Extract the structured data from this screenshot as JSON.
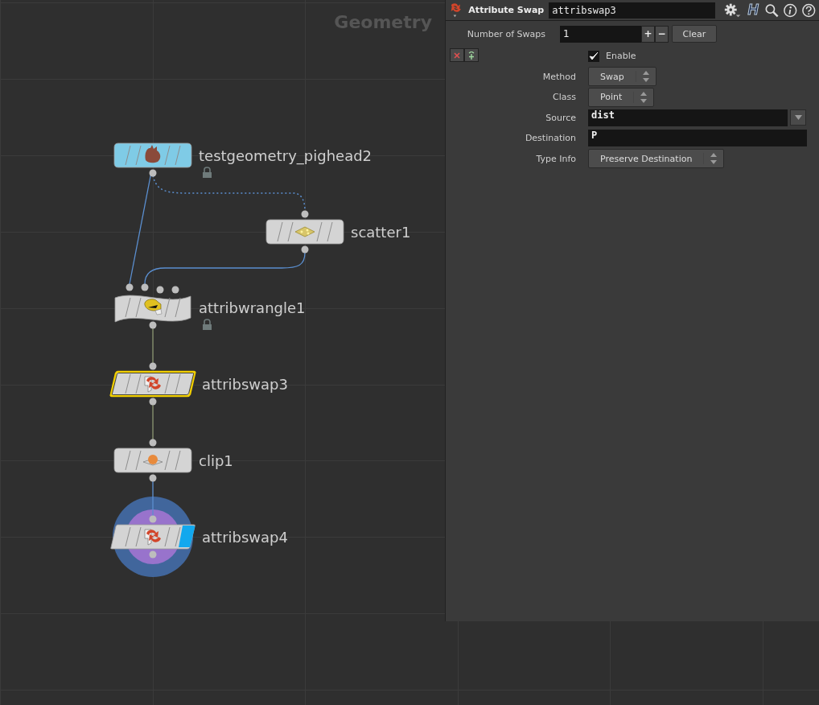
{
  "network": {
    "title": "Geometry",
    "nodes": [
      {
        "name": "testgeometry_pighead2",
        "kind": "pighead",
        "color": "#7fcbe6",
        "selected": false,
        "locked": true,
        "display": false
      },
      {
        "name": "scatter1",
        "kind": "scatter",
        "color": "#d4d4d4",
        "selected": false,
        "locked": false,
        "display": false
      },
      {
        "name": "attribwrangle1",
        "kind": "wrangle",
        "color": "#d4d4d4",
        "selected": false,
        "locked": true,
        "display": false
      },
      {
        "name": "attribswap3",
        "kind": "swap",
        "color": "#d4d4d4",
        "selected": true,
        "locked": false,
        "display": false
      },
      {
        "name": "clip1",
        "kind": "clip",
        "color": "#d4d4d4",
        "selected": false,
        "locked": false,
        "display": false
      },
      {
        "name": "attribswap4",
        "kind": "swap",
        "color": "#d4d4d4",
        "selected": false,
        "locked": false,
        "display": true
      }
    ]
  },
  "parameters": {
    "node_type": "Attribute Swap",
    "node_name": "attribswap3",
    "logo": "H",
    "count_label": "Number of Swaps",
    "count": "1",
    "add": "+",
    "remove": "−",
    "clear": "Clear",
    "fields": [
      {
        "kind": "checkbox",
        "label": "Enable",
        "checked": true
      },
      {
        "kind": "menu",
        "label": "Method",
        "value": "Swap"
      },
      {
        "kind": "menu",
        "label": "Class",
        "value": "Point"
      },
      {
        "kind": "string_menu",
        "label": "Source",
        "value": "dist"
      },
      {
        "kind": "string",
        "label": "Destination",
        "value": "P"
      },
      {
        "kind": "menu",
        "label": "Type Info",
        "value": "Preserve Destination"
      }
    ]
  }
}
